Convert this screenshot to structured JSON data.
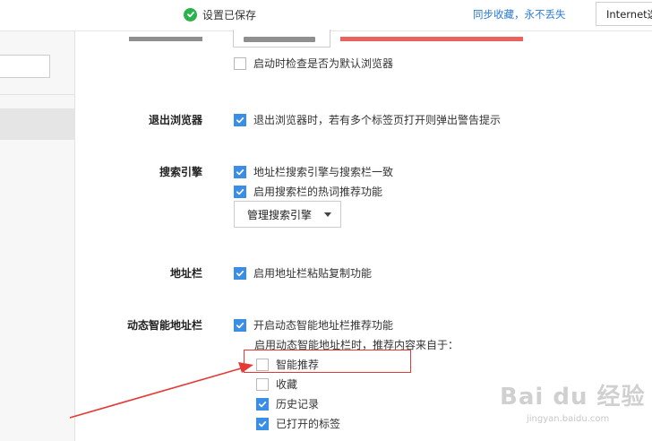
{
  "topbar": {
    "saved_text": "设置已保存",
    "sync_link": "同步收藏，永不丢失",
    "ie_button": "Internet选"
  },
  "sections": {
    "startup": {
      "check_default_browser": {
        "label": "启动时检查是否为默认浏览器",
        "checked": false
      }
    },
    "exit": {
      "title": "退出浏览器",
      "warn_multi_tabs": {
        "label": "退出浏览器时，若有多个标签页打开则弹出警告提示",
        "checked": true
      }
    },
    "search_engine": {
      "title": "搜索引擎",
      "sync_address_search": {
        "label": "地址栏搜索引擎与搜索栏一致",
        "checked": true
      },
      "hot_words": {
        "label": "启用搜索栏的热词推荐功能",
        "checked": true
      },
      "manage_button": "管理搜索引擎"
    },
    "address_bar": {
      "title": "地址栏",
      "paste_copy": {
        "label": "启用地址栏粘贴复制功能",
        "checked": true
      }
    },
    "smart_address": {
      "title": "动态智能地址栏",
      "enable": {
        "label": "开启动态智能地址栏推荐功能",
        "checked": true
      },
      "source_text": "启用动态智能地址栏时，推荐内容来自于：",
      "options": [
        {
          "label": "智能推荐",
          "checked": false
        },
        {
          "label": "收藏",
          "checked": false
        },
        {
          "label": "历史记录",
          "checked": true
        },
        {
          "label": "已打开的标签",
          "checked": true
        }
      ]
    }
  },
  "watermark": {
    "brand": "Bai du 经验",
    "url": "jingyan.baidu.com"
  },
  "colors": {
    "accent": "#3b8ee8",
    "success": "#2bb24c",
    "link": "#2d7bd6",
    "annotation": "#e53935"
  }
}
